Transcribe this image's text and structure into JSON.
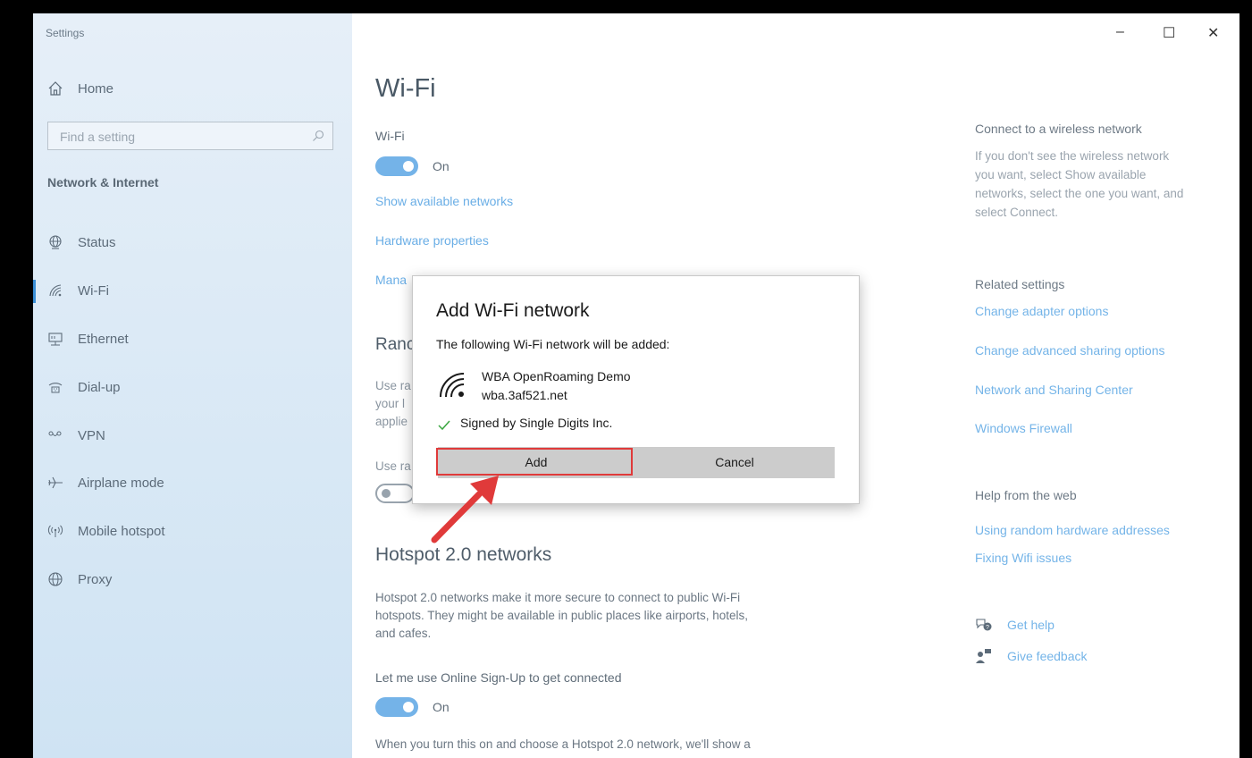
{
  "window": {
    "title": "Settings",
    "controls": {
      "minimize": "–",
      "maximize": "☐",
      "close": "✕"
    }
  },
  "sidebar": {
    "home": {
      "label": "Home",
      "icon": "home-icon"
    },
    "search": {
      "placeholder": "Find a setting"
    },
    "section": "Network & Internet",
    "items": [
      {
        "label": "Status",
        "icon": "globe-status-icon"
      },
      {
        "label": "Wi-Fi",
        "icon": "wifi-icon",
        "active": true
      },
      {
        "label": "Ethernet",
        "icon": "ethernet-icon"
      },
      {
        "label": "Dial-up",
        "icon": "dialup-icon"
      },
      {
        "label": "VPN",
        "icon": "vpn-icon"
      },
      {
        "label": "Airplane mode",
        "icon": "airplane-icon"
      },
      {
        "label": "Mobile hotspot",
        "icon": "hotspot-icon"
      },
      {
        "label": "Proxy",
        "icon": "globe-proxy-icon"
      }
    ]
  },
  "main": {
    "title": "Wi-Fi",
    "wifi_label": "Wi-Fi",
    "wifi_toggle": "On",
    "show_networks": "Show available networks",
    "hardware_props": "Hardware properties",
    "manage_partial": "Mana",
    "random_partial": "Ranc",
    "random_desc_partial": [
      "Use ra",
      "your l",
      "applie"
    ],
    "use_random_partial": "Use ra",
    "hotspot_title": "Hotspot 2.0 networks",
    "hotspot_desc": [
      "Hotspot 2.0 networks make it more secure to connect to public Wi-Fi",
      "hotspots. They might be available in public places like airports, hotels,",
      "and cafes."
    ],
    "online_signup_label": "Let me use Online Sign-Up to get connected",
    "online_signup_toggle": "On",
    "bottom_text": "When you turn this on and choose a Hotspot 2.0 network, we'll show a"
  },
  "right_panel": {
    "connect_heading": "Connect to a wireless network",
    "connect_text": [
      "If you don't see the wireless network",
      "you want, select Show available",
      "networks, select the one you want, and",
      "select Connect."
    ],
    "related_heading": "Related settings",
    "related_links": [
      "Change adapter options",
      "Change advanced sharing options",
      "Network and Sharing Center",
      "Windows Firewall"
    ],
    "help_heading": "Help from the web",
    "help_links": [
      "Using random hardware addresses",
      "Fixing Wifi issues"
    ],
    "get_help": "Get help",
    "give_feedback": "Give feedback"
  },
  "dialog": {
    "title": "Add Wi-Fi network",
    "subtitle": "The following Wi-Fi network will be added:",
    "network_name": "WBA OpenRoaming Demo",
    "network_domain": "wba.3af521.net",
    "signed_by": "Signed by Single Digits Inc.",
    "add_label": "Add",
    "cancel_label": "Cancel"
  },
  "colors": {
    "accent": "#74b3e8",
    "highlight": "#e03a3a",
    "sidebar": "#dbe9f5"
  }
}
